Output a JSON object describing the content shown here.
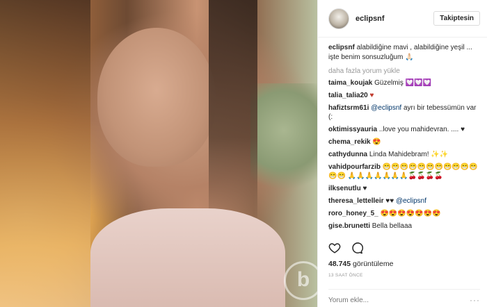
{
  "post": {
    "photo_alt": "selfie",
    "watermark": "b"
  },
  "header": {
    "username": "eclipsnf",
    "follow_label": "Takiptesin"
  },
  "caption": {
    "user": "eclipsnf",
    "text": "alabildiğine mavi , alabildiğine yeşil ... işte benim sonsuzluğum 🙏🏻"
  },
  "load_more_label": "daha fazla yorum yükle",
  "comments": [
    {
      "user": "taima_koujak",
      "text": "Güzelmiş 💟💟💟"
    },
    {
      "user": "talia_talia20",
      "text": "♥"
    },
    {
      "user": "hafiztsrm61i",
      "mention": "@eclipsnf",
      "text": "ayrı bir tebessümün var (:"
    },
    {
      "user": "oktimissyauria",
      "text": "..love you mahidevran. .... ♥"
    },
    {
      "user": "chema_rekik",
      "text": "😍"
    },
    {
      "user": "cathydunna",
      "text": "Linda Mahidebram! ✨✨"
    },
    {
      "user": "vahidpourfarzib",
      "text": "😁😁😁😁😁😁😁😁😁😁😁😁😁 🙏🙏🙏🙏🙏🙏🙏🍒🍒🍒🍒"
    },
    {
      "user": "ilksenutlu",
      "text": "♥"
    },
    {
      "user": "theresa_lettelleir",
      "mention": "@eclipsnf",
      "text": "♥♥"
    },
    {
      "user": "roro_honey_5_",
      "text": "😍😍😍😍😍😍😍"
    },
    {
      "user": "gise.brunetti",
      "text": "Bella bellaaa"
    }
  ],
  "actions": {
    "like_icon": "heart-icon",
    "comment_icon": "comment-icon"
  },
  "views": {
    "count": "48.745",
    "label": "görüntüleme"
  },
  "time": "13 SAAT ÖNCE",
  "comment_box": {
    "placeholder": "Yorum ekle...",
    "more_label": "···"
  }
}
